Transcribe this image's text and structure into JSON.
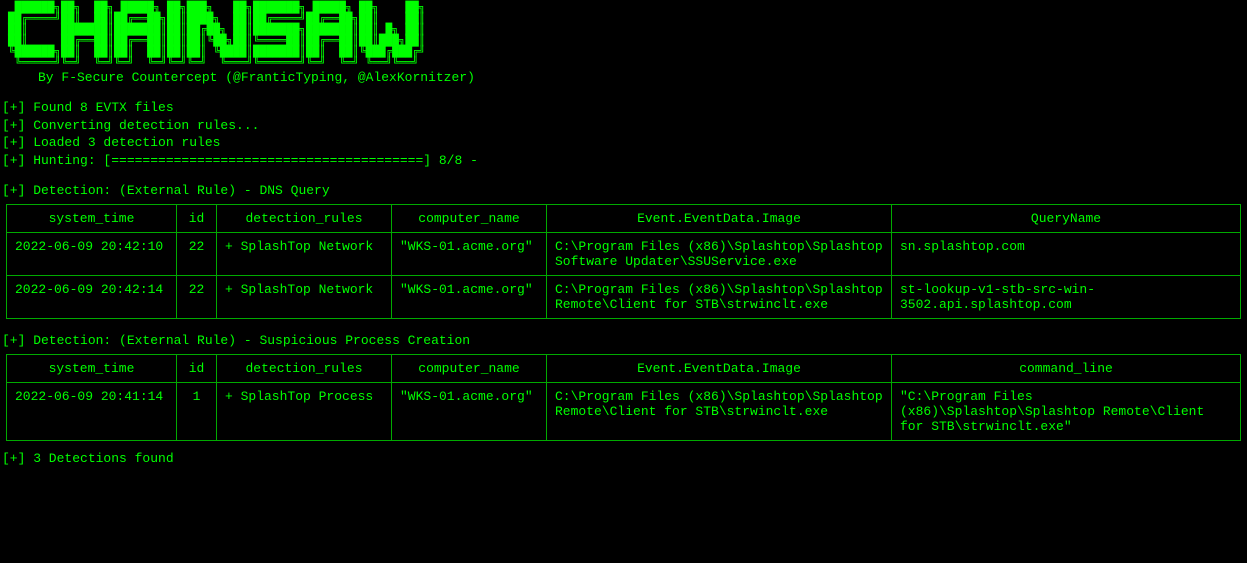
{
  "logo_text": "CHAINSAW",
  "byline": "By F-Secure Countercept (@FranticTyping, @AlexKornitzer)",
  "status_lines": [
    "[+] Found 8 EVTX files",
    "[+] Converting detection rules...",
    "[+] Loaded 3 detection rules",
    "[+] Hunting: [========================================] 8/8 -"
  ],
  "detections": [
    {
      "header": "[+] Detection: (External Rule) - DNS Query",
      "columns": [
        "system_time",
        "id",
        "detection_rules",
        "computer_name",
        "Event.EventData.Image",
        "QueryName"
      ],
      "rows": [
        {
          "system_time": "2022-06-09 20:42:10",
          "id": "22",
          "detection_rules": "+ SplashTop Network",
          "computer_name": "\"WKS-01.acme.org\"",
          "image": "C:\\Program Files (x86)\\Splashtop\\Splashtop Software Updater\\SSUService.exe",
          "last": "sn.splashtop.com"
        },
        {
          "system_time": "2022-06-09 20:42:14",
          "id": "22",
          "detection_rules": "+ SplashTop Network",
          "computer_name": "\"WKS-01.acme.org\"",
          "image": "C:\\Program Files (x86)\\Splashtop\\Splashtop Remote\\Client for STB\\strwinclt.exe",
          "last": "st-lookup-v1-stb-src-win-3502.api.splashtop.com"
        }
      ]
    },
    {
      "header": "[+] Detection: (External Rule) - Suspicious Process Creation",
      "columns": [
        "system_time",
        "id",
        "detection_rules",
        "computer_name",
        "Event.EventData.Image",
        "command_line"
      ],
      "rows": [
        {
          "system_time": "2022-06-09 20:41:14",
          "id": "1",
          "detection_rules": "+ SplashTop Process",
          "computer_name": "\"WKS-01.acme.org\"",
          "image": "C:\\Program Files (x86)\\Splashtop\\Splashtop Remote\\Client for STB\\strwinclt.exe",
          "last": "\"C:\\Program Files (x86)\\Splashtop\\Splashtop Remote\\Client for STB\\strwinclt.exe\""
        }
      ]
    }
  ],
  "summary": "[+] 3 Detections found"
}
